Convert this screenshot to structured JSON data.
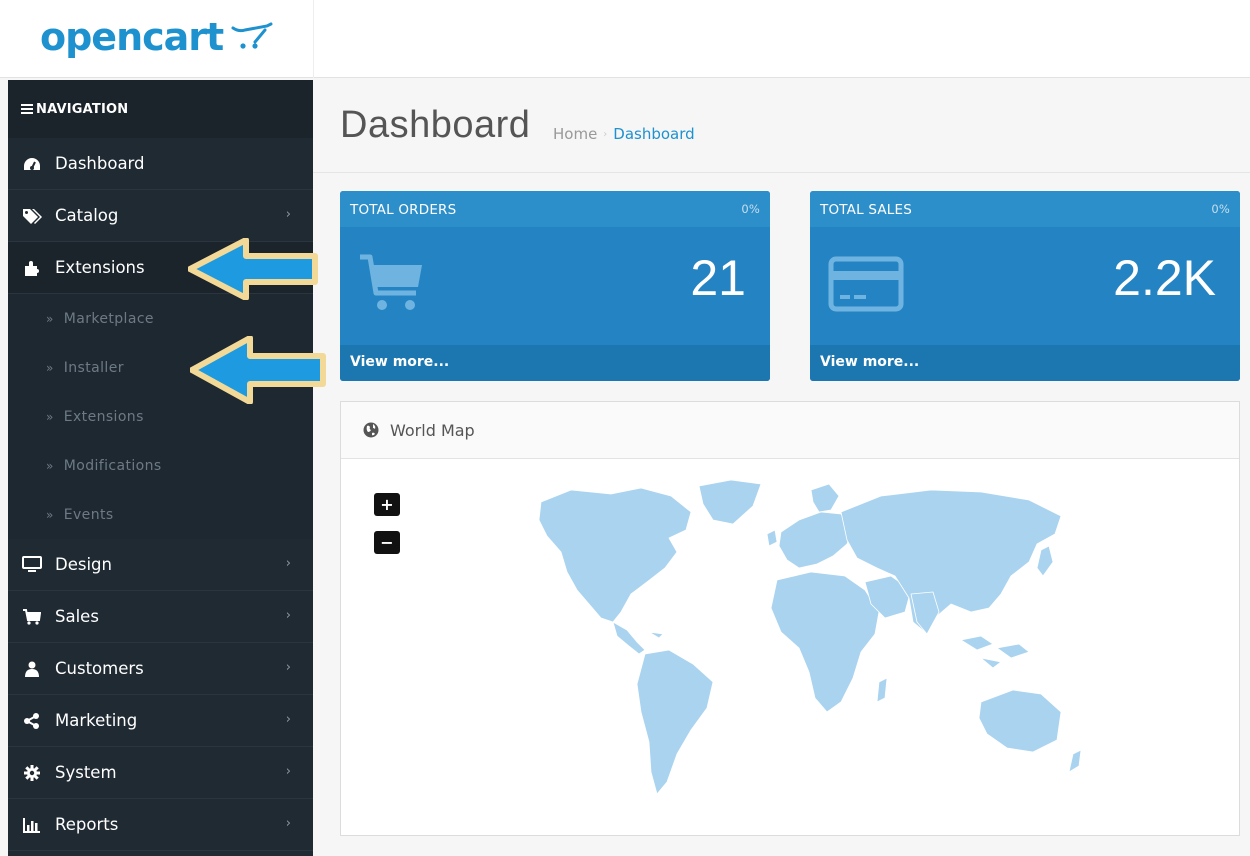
{
  "logo": {
    "text": "opencart"
  },
  "sidebar": {
    "heading": "NAVIGATION",
    "items": [
      {
        "label": "Dashboard",
        "icon": "dashboard-icon",
        "has_chevron": false
      },
      {
        "label": "Catalog",
        "icon": "tags-icon",
        "has_chevron": true
      },
      {
        "label": "Extensions",
        "icon": "puzzle-icon",
        "has_chevron": false,
        "active": true
      },
      {
        "label": "Design",
        "icon": "monitor-icon",
        "has_chevron": true
      },
      {
        "label": "Sales",
        "icon": "cart-icon",
        "has_chevron": true
      },
      {
        "label": "Customers",
        "icon": "user-icon",
        "has_chevron": true
      },
      {
        "label": "Marketing",
        "icon": "share-icon",
        "has_chevron": true
      },
      {
        "label": "System",
        "icon": "cog-icon",
        "has_chevron": true
      },
      {
        "label": "Reports",
        "icon": "bar-chart-icon",
        "has_chevron": true
      }
    ],
    "sub_items": [
      "Marketplace",
      "Installer",
      "Extensions",
      "Modifications",
      "Events"
    ],
    "sub_bullet": "»",
    "chevron": "›"
  },
  "page": {
    "title": "Dashboard",
    "breadcrumb": [
      "Home",
      "Dashboard"
    ],
    "breadcrumb_sep": "›"
  },
  "tiles": [
    {
      "title": "TOTAL ORDERS",
      "percent": "0%",
      "value": "21",
      "link": "View more...",
      "icon": "cart-icon"
    },
    {
      "title": "TOTAL SALES",
      "percent": "0%",
      "value": "2.2K",
      "link": "View more...",
      "icon": "credit-card-icon"
    }
  ],
  "map_panel": {
    "title": "World Map",
    "zoom_in": "+",
    "zoom_out": "−"
  },
  "colors": {
    "brand": "#1e91cf",
    "sidebar": "#202a33",
    "tile": "#2484c3",
    "map_land": "#a9d3ef",
    "arrow_fill": "#1e9be0",
    "arrow_border": "#f3d998"
  }
}
